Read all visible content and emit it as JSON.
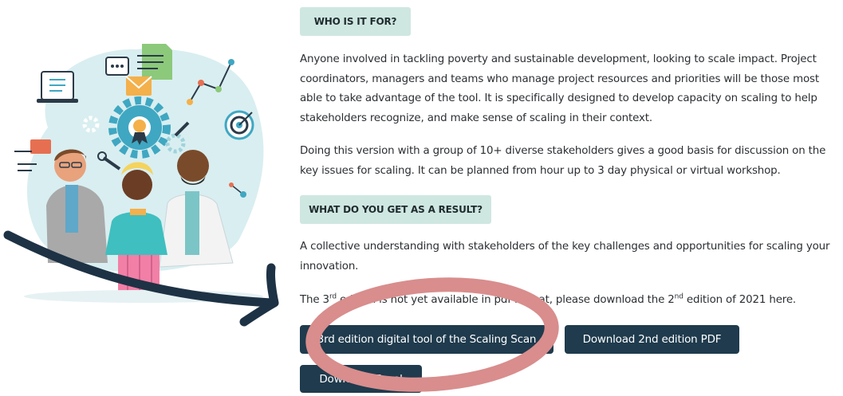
{
  "sections": {
    "who_heading": "WHO IS IT FOR?",
    "who_text_1": "Anyone involved in tackling poverty and sustainable development, looking to scale impact. Project coordinators, managers and teams who manage project resources and priorities will be those most able to take advantage of the tool. It is specifically designed to develop capacity on scaling to help stakeholders recognize, and make sense of scaling in their context.",
    "who_text_2": "Doing this version with a group of 10+ diverse stakeholders gives a good basis for discussion on the key issues for scaling. It can be planned from hour up to 3 day physical or virtual workshop.",
    "result_heading": "WHAT DO YOU GET AS A RESULT?",
    "result_text": "A  collective understanding with stakeholders of the key challenges and opportunities for scaling your innovation."
  },
  "download_note": {
    "part1": "The 3",
    "sup1": "rd",
    "part2": " edition is not yet available in pdf format, please download the 2",
    "sup2": "nd",
    "part3": " edition of 2021 here."
  },
  "buttons": {
    "digital_tool": "3rd edition digital tool of the Scaling Scan",
    "pdf": "Download 2nd edition PDF",
    "excel": "Download Excel"
  },
  "colors": {
    "tag_bg": "#cfe7e1",
    "button_bg": "#1f3b4d",
    "annotation_circle": "#d98d8d",
    "annotation_arrow": "#1e3245"
  },
  "icons": [
    "document-icon",
    "chat-icon",
    "email-icon",
    "gear-icon",
    "award-icon",
    "target-icon",
    "pencil-icon",
    "wrench-icon",
    "network-icon"
  ]
}
